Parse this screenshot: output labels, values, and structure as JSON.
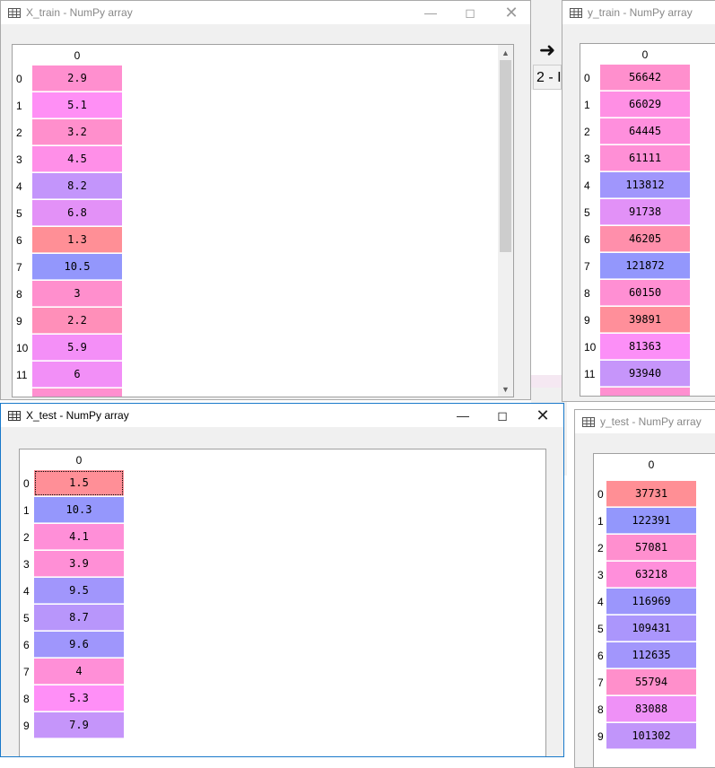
{
  "background": {
    "nav_back_icon": "arrow-left-icon",
    "tab_fragment": "2 - I"
  },
  "x_train": {
    "title": "X_train - NumPy array",
    "column_header": "0",
    "rows": [
      {
        "index": "0",
        "value": "2.9",
        "color": "#ff8fcf"
      },
      {
        "index": "1",
        "value": "5.1",
        "color": "#ff8ff5"
      },
      {
        "index": "2",
        "value": "3.2",
        "color": "#ff8fcc"
      },
      {
        "index": "3",
        "value": "4.5",
        "color": "#ff8fe8"
      },
      {
        "index": "4",
        "value": "8.2",
        "color": "#c395fb"
      },
      {
        "index": "5",
        "value": "6.8",
        "color": "#e391f7"
      },
      {
        "index": "6",
        "value": "1.3",
        "color": "#ff8f96"
      },
      {
        "index": "7",
        "value": "10.5",
        "color": "#9397fc"
      },
      {
        "index": "8",
        "value": "3",
        "color": "#ff8fcd"
      },
      {
        "index": "9",
        "value": "2.2",
        "color": "#ff8fb9"
      },
      {
        "index": "10",
        "value": "5.9",
        "color": "#f48ff7"
      },
      {
        "index": "11",
        "value": "6",
        "color": "#f28ff7"
      }
    ]
  },
  "y_train": {
    "title": "y_train - NumPy array",
    "column_header": "0",
    "rows": [
      {
        "index": "0",
        "value": "56642",
        "color": "#ff8fcd"
      },
      {
        "index": "1",
        "value": "66029",
        "color": "#ff8fe4"
      },
      {
        "index": "2",
        "value": "64445",
        "color": "#ff8fdd"
      },
      {
        "index": "3",
        "value": "61111",
        "color": "#ff8fd6"
      },
      {
        "index": "4",
        "value": "113812",
        "color": "#a096fc"
      },
      {
        "index": "5",
        "value": "91738",
        "color": "#e291f7"
      },
      {
        "index": "6",
        "value": "46205",
        "color": "#ff8fab"
      },
      {
        "index": "7",
        "value": "121872",
        "color": "#9397fc"
      },
      {
        "index": "8",
        "value": "60150",
        "color": "#ff8fd3"
      },
      {
        "index": "9",
        "value": "39891",
        "color": "#ff8f9a"
      },
      {
        "index": "10",
        "value": "81363",
        "color": "#fc8ff7"
      },
      {
        "index": "11",
        "value": "93940",
        "color": "#c695fa"
      }
    ]
  },
  "x_test": {
    "title": "X_test - NumPy array",
    "column_header": "0",
    "rows": [
      {
        "index": "0",
        "value": "1.5",
        "color": "#ff8f97"
      },
      {
        "index": "1",
        "value": "10.3",
        "color": "#9597fc"
      },
      {
        "index": "2",
        "value": "4.1",
        "color": "#ff8fd8"
      },
      {
        "index": "3",
        "value": "3.9",
        "color": "#ff8fd6"
      },
      {
        "index": "4",
        "value": "9.5",
        "color": "#a196fc"
      },
      {
        "index": "5",
        "value": "8.7",
        "color": "#b896fb"
      },
      {
        "index": "6",
        "value": "9.6",
        "color": "#9f96fc"
      },
      {
        "index": "7",
        "value": "4",
        "color": "#ff8fd7"
      },
      {
        "index": "8",
        "value": "5.3",
        "color": "#ff8ff7"
      },
      {
        "index": "9",
        "value": "7.9",
        "color": "#c595fa"
      }
    ]
  },
  "y_test": {
    "title": "y_test - NumPy array",
    "column_header": "0",
    "rows": [
      {
        "index": "0",
        "value": "37731",
        "color": "#ff8f95"
      },
      {
        "index": "1",
        "value": "122391",
        "color": "#9397fc"
      },
      {
        "index": "2",
        "value": "57081",
        "color": "#ff8fcf"
      },
      {
        "index": "3",
        "value": "63218",
        "color": "#ff8fdb"
      },
      {
        "index": "4",
        "value": "116969",
        "color": "#9b96fc"
      },
      {
        "index": "5",
        "value": "109431",
        "color": "#ab96fc"
      },
      {
        "index": "6",
        "value": "112635",
        "color": "#a296fc"
      },
      {
        "index": "7",
        "value": "55794",
        "color": "#ff8fcb"
      },
      {
        "index": "8",
        "value": "83088",
        "color": "#ef91f7"
      },
      {
        "index": "9",
        "value": "101302",
        "color": "#c195fa"
      }
    ]
  },
  "window_controls": {
    "minimize_icon": "minimize-icon",
    "maximize_icon": "maximize-icon",
    "close_icon": "close-icon",
    "table_icon": "table-grid-icon"
  }
}
